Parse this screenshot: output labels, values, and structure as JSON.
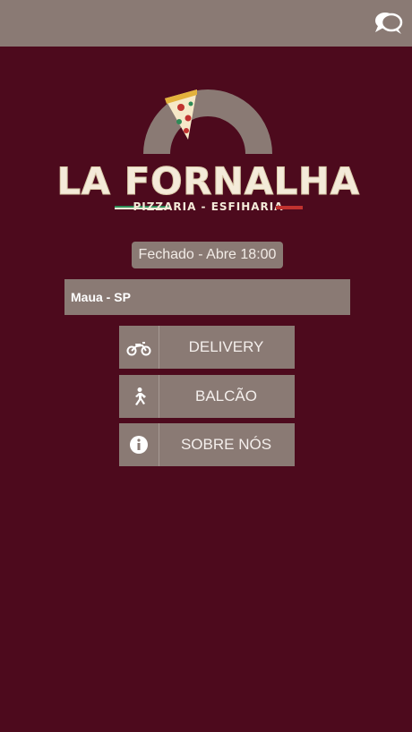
{
  "header": {
    "chat_icon": "chat-bubbles-icon"
  },
  "logo": {
    "name": "LA FORNALHA",
    "subtitle": "PIZZARIA - ESFIHARIA",
    "colors": {
      "oven": "#8a7a74",
      "cream": "#f4ebd9",
      "green": "#2e8b57",
      "red": "#c0322f"
    }
  },
  "status": {
    "text": "Fechado - Abre 18:00"
  },
  "location": {
    "selected": "Maua - SP"
  },
  "menu": {
    "delivery": {
      "label": "DELIVERY",
      "icon": "motorcycle-icon"
    },
    "balcao": {
      "label": "BALCÃO",
      "icon": "walking-person-icon"
    },
    "sobre": {
      "label": "SOBRE NÓS",
      "icon": "info-icon"
    }
  },
  "colors": {
    "background": "#4d0a1d",
    "bar": "#8a7a74",
    "text": "#f4efec"
  }
}
